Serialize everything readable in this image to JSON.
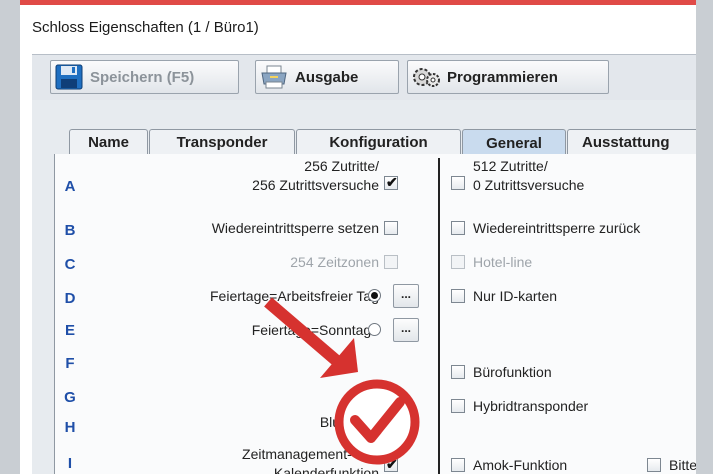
{
  "window": {
    "title": "Schloss Eigenschaften (1 / Büro1)"
  },
  "toolbar": {
    "save_label": "Speichern (F5)",
    "output_label": "Ausgabe",
    "program_label": "Programmieren"
  },
  "tabs": [
    {
      "label": "Name"
    },
    {
      "label": "Transponder"
    },
    {
      "label": "Konfiguration"
    },
    {
      "label": "General"
    },
    {
      "label": "Ausstattung"
    }
  ],
  "active_tab": "General",
  "rows": {
    "A": {
      "letter": "A",
      "left_line1": "256 Zutritte/",
      "left_line2": "256 Zutrittsversuche",
      "left_checked": true,
      "right_line1": "512 Zutritte/",
      "right_line2": "0 Zutrittsversuche",
      "right_checked": false
    },
    "B": {
      "letter": "B",
      "left": "Wiedereintrittsperre setzen",
      "left_checked": false,
      "right": "Wiedereintrittsperre zurück",
      "right_checked": false
    },
    "C": {
      "letter": "C",
      "left": "254 Zeitzonen",
      "left_checked": false,
      "left_disabled": true,
      "right": "Hotel-line",
      "right_checked": false,
      "right_disabled": true
    },
    "D": {
      "letter": "D",
      "left": "Feiertage=Arbeitsfreier Tag",
      "left_selected": true,
      "right": "Nur ID-karten",
      "right_checked": false
    },
    "E": {
      "letter": "E",
      "left": "Feiertage=Sonntage",
      "left_selected": false
    },
    "F": {
      "letter": "F",
      "right": "Bürofunktion",
      "right_checked": false
    },
    "G": {
      "letter": "G",
      "right": "Hybridtransponder",
      "right_checked": false
    },
    "H": {
      "letter": "H",
      "left": "Bluetooth",
      "left_checked": true
    },
    "I": {
      "letter": "I",
      "left_line1": "Zeitmanagement- und",
      "left_line2": "Kalenderfunktion",
      "left_checked": true,
      "right": "Amok-Funktion",
      "right_checked": false,
      "right2": "Bitte"
    }
  },
  "more_button_label": "...",
  "colors": {
    "accent_red": "#d6322f",
    "letter_blue": "#1f4fa8",
    "active_tab": "#c9dbee"
  }
}
